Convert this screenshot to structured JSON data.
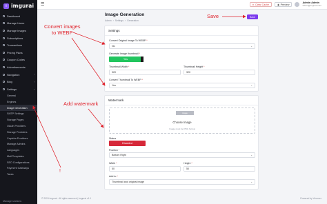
{
  "app": {
    "logo_letter": "i",
    "logo_text": "imgurai"
  },
  "sidebar": {
    "items": [
      {
        "label": "Dashboard",
        "icon": "home-icon"
      },
      {
        "label": "Manage Users",
        "icon": "users-icon"
      },
      {
        "label": "Manage Images",
        "icon": "image-icon"
      },
      {
        "label": "Subscriptions",
        "icon": "card-icon"
      },
      {
        "label": "Transactions",
        "icon": "exchange-icon"
      },
      {
        "label": "Pricing Plans",
        "icon": "tag-icon"
      },
      {
        "label": "Coupon Codes",
        "icon": "ticket-icon"
      },
      {
        "label": "Advertisements",
        "icon": "megaphone-icon"
      },
      {
        "label": "Navigation",
        "icon": "compass-icon",
        "chevron": "›"
      },
      {
        "label": "Blog",
        "icon": "pen-icon",
        "chevron": "›"
      },
      {
        "label": "Settings",
        "icon": "gear-icon",
        "chevron": "⌄"
      }
    ],
    "subitems": [
      "General",
      "Engines",
      "Image Generation",
      "SMTP Settings",
      "Storage Pages",
      "OAuth Providers",
      "Storage Providers",
      "Captcha Providers",
      "Manage Admins",
      "Languages",
      "Mail Templates",
      "SEO Configurations",
      "Payment Gateways",
      "Taxes"
    ],
    "active_subitem": "Image Generation",
    "footer": "Manage sections"
  },
  "topbar": {
    "clear_cache": "Clear Cache",
    "preview": "Preview",
    "admin_name": "Admin Admin",
    "admin_email": "admin@imgurai.com"
  },
  "page": {
    "title": "Image Generation",
    "breadcrumb": [
      "Admin",
      "›",
      "Settings",
      "›",
      "Generation"
    ],
    "save_label": "Save"
  },
  "settings": {
    "title": "Settings",
    "convert_label": "Convert Original Image To WEBP",
    "convert_value": "No",
    "thumbnail_label": "Generate Image thumbnail",
    "thumbnail_toggle": "Yes",
    "thumb_width_label": "Thumbnail Width",
    "thumb_width_value": "320",
    "thumb_height_label": "Thumbnail Height",
    "thumb_height_value": "320",
    "convert_thumb_label": "Convert Thumbnail To WEBP",
    "convert_thumb_value": "Yes"
  },
  "watermark": {
    "title": "Watermark",
    "thumb_placeholder": "image",
    "choose_image": "Choose Image",
    "image_hint": "Image must be PNG format",
    "status_label": "Status",
    "status_value": "Disabled",
    "position_label": "Position",
    "position_value": "Bottom Right",
    "width_label": "Width",
    "width_value": "50",
    "height_label": "Height",
    "height_value": "50",
    "add_to_label": "Add to",
    "add_to_value": "Thumbnail and original image"
  },
  "footer": {
    "left": "© 2024 imgurai - All rights reserved | imgurai v1.1",
    "right": "Powered by Vironeer"
  },
  "annotations": {
    "save": "Save",
    "convert": "Convert images\nto WEBP",
    "watermark": "Add watermark",
    "nav_mark": "!"
  },
  "colors": {
    "accent": "#7c3aed",
    "annotation": "#e0242d",
    "toggle_on": "#22c55e",
    "toggle_off": "#d62839",
    "sidebar_bg": "#15161c"
  }
}
